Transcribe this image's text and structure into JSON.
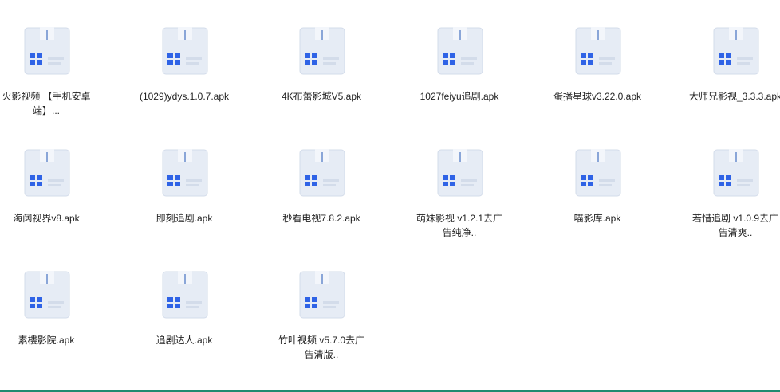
{
  "files": [
    {
      "name": "火影视频 【手机安卓端】...",
      "icon": "apk-package-icon"
    },
    {
      "name": "(1029)ydys.1.0.7.apk",
      "icon": "apk-package-icon"
    },
    {
      "name": "4K布蕾影城V5.apk",
      "icon": "apk-package-icon"
    },
    {
      "name": "1027feiyu追剧.apk",
      "icon": "apk-package-icon"
    },
    {
      "name": "蛋播星球v3.22.0.apk",
      "icon": "apk-package-icon"
    },
    {
      "name": "大师兄影视_3.3.3.apk",
      "icon": "apk-package-icon"
    },
    {
      "name": "海阔视界v8.apk",
      "icon": "apk-package-icon"
    },
    {
      "name": "即刻追剧.apk",
      "icon": "apk-package-icon"
    },
    {
      "name": "秒看电视7.8.2.apk",
      "icon": "apk-package-icon"
    },
    {
      "name": "萌妹影视 v1.2.1去广告纯净..",
      "icon": "apk-package-icon"
    },
    {
      "name": "喵影库.apk",
      "icon": "apk-package-icon"
    },
    {
      "name": "若惜追剧 v1.0.9去广告清爽..",
      "icon": "apk-package-icon"
    },
    {
      "name": "素樓影院.apk",
      "icon": "apk-package-icon"
    },
    {
      "name": "追剧达人.apk",
      "icon": "apk-package-icon"
    },
    {
      "name": "竹叶视频 v5.7.0去广告清版..",
      "icon": "apk-package-icon"
    }
  ],
  "colors": {
    "icon_box": "#e6ecf5",
    "icon_box_edge": "#d3dcea",
    "icon_accent": "#2f63e6",
    "text": "#222222",
    "bottom_accent": "#1f8a70"
  }
}
